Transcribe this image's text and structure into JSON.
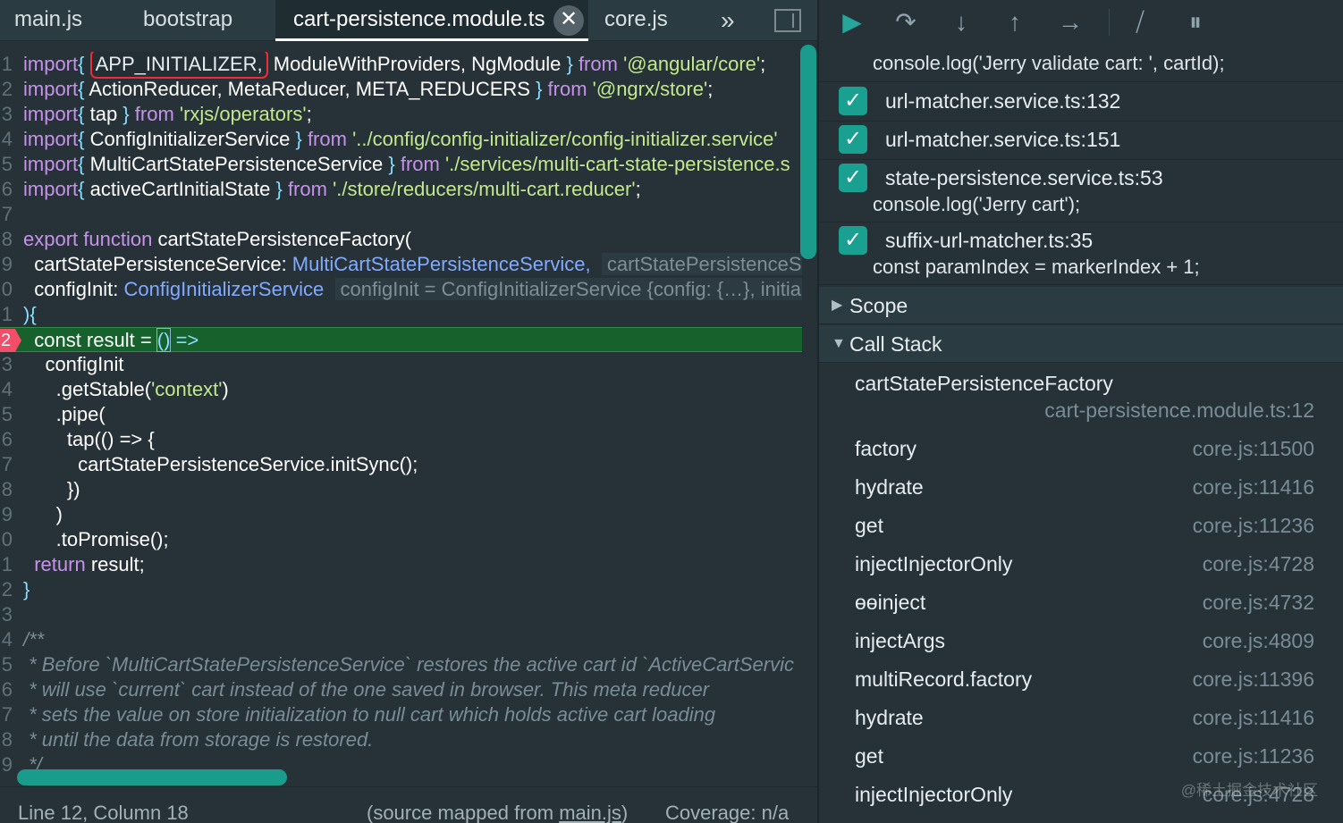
{
  "tabs": [
    {
      "label": "main.js",
      "active": false
    },
    {
      "label": "bootstrap",
      "active": false
    },
    {
      "label": "cart-persistence.module.ts",
      "active": true
    },
    {
      "label": "core.js",
      "active": false
    }
  ],
  "tab_close_glyph": "✕",
  "tab_overflow_glyph": "»",
  "breakpoint_line": "2",
  "status": {
    "position": "Line 12, Column 18",
    "source_mapped_prefix": "(source mapped from ",
    "source_mapped_file": "main.js",
    "source_mapped_suffix": ")",
    "coverage": "Coverage: n/a"
  },
  "code_lines": [
    {
      "no": "1",
      "parts": [
        [
          "kw",
          "import"
        ],
        [
          "pn",
          "{ "
        ],
        [
          "box",
          "APP_INITIALIZER,"
        ],
        [
          "fn",
          " ModuleWithProviders, NgModule "
        ],
        [
          "pn",
          "} "
        ],
        [
          "kw",
          "from "
        ],
        [
          "str",
          "'@angular/core'"
        ],
        [
          "fn",
          ";"
        ]
      ]
    },
    {
      "no": "2",
      "parts": [
        [
          "kw",
          "import"
        ],
        [
          "pn",
          "{ "
        ],
        [
          "fn",
          "ActionReducer, MetaReducer, META_REDUCERS "
        ],
        [
          "pn",
          "} "
        ],
        [
          "kw",
          "from "
        ],
        [
          "str",
          "'@ngrx/store'"
        ],
        [
          "fn",
          ";"
        ]
      ]
    },
    {
      "no": "3",
      "parts": [
        [
          "kw",
          "import"
        ],
        [
          "pn",
          "{ "
        ],
        [
          "fn",
          "tap "
        ],
        [
          "pn",
          "} "
        ],
        [
          "kw",
          "from "
        ],
        [
          "str",
          "'rxjs/operators'"
        ],
        [
          "fn",
          ";"
        ]
      ]
    },
    {
      "no": "4",
      "parts": [
        [
          "kw",
          "import"
        ],
        [
          "pn",
          "{ "
        ],
        [
          "fn",
          "ConfigInitializerService "
        ],
        [
          "pn",
          "} "
        ],
        [
          "kw",
          "from "
        ],
        [
          "str",
          "'../config/config-initializer/config-initializer.service'"
        ]
      ]
    },
    {
      "no": "5",
      "parts": [
        [
          "kw",
          "import"
        ],
        [
          "pn",
          "{ "
        ],
        [
          "fn",
          "MultiCartStatePersistenceService "
        ],
        [
          "pn",
          "} "
        ],
        [
          "kw",
          "from "
        ],
        [
          "str",
          "'./services/multi-cart-state-persistence.s"
        ]
      ]
    },
    {
      "no": "6",
      "parts": [
        [
          "kw",
          "import"
        ],
        [
          "pn",
          "{ "
        ],
        [
          "fn",
          "activeCartInitialState "
        ],
        [
          "pn",
          "} "
        ],
        [
          "kw",
          "from "
        ],
        [
          "str",
          "'./store/reducers/multi-cart.reducer'"
        ],
        [
          "fn",
          ";"
        ]
      ]
    },
    {
      "no": "7",
      "parts": []
    },
    {
      "no": "8",
      "parts": [
        [
          "kw",
          "export function "
        ],
        [
          "fn",
          "cartStatePersistenceFactory("
        ]
      ]
    },
    {
      "no": "9",
      "parts": [
        [
          "fn",
          "  cartStatePersistenceService: "
        ],
        [
          "ty",
          "MultiCartStatePersistenceService,"
        ],
        [
          "fn",
          "  "
        ],
        [
          "inl",
          "cartStatePersistenceS"
        ]
      ]
    },
    {
      "no": "0",
      "parts": [
        [
          "fn",
          "  configInit: "
        ],
        [
          "ty",
          "ConfigInitializerService"
        ],
        [
          "fn",
          "  "
        ],
        [
          "inl",
          "configInit = ConfigInitializerService {config: {…}, initia"
        ]
      ]
    },
    {
      "no": "1",
      "parts": [
        [
          "pn",
          "){"
        ]
      ]
    },
    {
      "no": "2",
      "hl": true,
      "parts": [
        [
          "fn",
          "  const result = "
        ],
        [
          "cur",
          "()"
        ],
        [
          "pn",
          " =>"
        ]
      ]
    },
    {
      "no": "3",
      "parts": [
        [
          "fn",
          "    configInit"
        ]
      ]
    },
    {
      "no": "4",
      "parts": [
        [
          "fn",
          "      .getStable("
        ],
        [
          "str",
          "'context'"
        ],
        [
          "fn",
          ")"
        ]
      ]
    },
    {
      "no": "5",
      "parts": [
        [
          "fn",
          "      .pipe("
        ]
      ]
    },
    {
      "no": "6",
      "parts": [
        [
          "fn",
          "        tap(() => {"
        ]
      ]
    },
    {
      "no": "7",
      "parts": [
        [
          "fn",
          "          cartStatePersistenceService.initSync();"
        ]
      ]
    },
    {
      "no": "8",
      "parts": [
        [
          "fn",
          "        })"
        ]
      ]
    },
    {
      "no": "9",
      "parts": [
        [
          "fn",
          "      )"
        ]
      ]
    },
    {
      "no": "0",
      "parts": [
        [
          "fn",
          "      .toPromise();"
        ]
      ]
    },
    {
      "no": "1",
      "parts": [
        [
          "kw",
          "  return "
        ],
        [
          "fn",
          "result;"
        ]
      ]
    },
    {
      "no": "2",
      "parts": [
        [
          "pn",
          "}"
        ]
      ]
    },
    {
      "no": "3",
      "parts": []
    },
    {
      "no": "4",
      "parts": [
        [
          "cm",
          "/**"
        ]
      ]
    },
    {
      "no": "5",
      "parts": [
        [
          "cm",
          " * Before `MultiCartStatePersistenceService` restores the active cart id `ActiveCartServic"
        ]
      ]
    },
    {
      "no": "6",
      "parts": [
        [
          "cm",
          " * will use `current` cart instead of the one saved in browser. This meta reducer"
        ]
      ]
    },
    {
      "no": "7",
      "parts": [
        [
          "cm",
          " * sets the value on store initialization to null cart which holds active cart loading"
        ]
      ]
    },
    {
      "no": "8",
      "parts": [
        [
          "cm",
          " * until the data from storage is restored."
        ]
      ]
    },
    {
      "no": "9",
      "parts": [
        [
          "cm",
          " */"
        ]
      ]
    }
  ],
  "toolbar_icons": [
    "resume-icon",
    "step-over-icon",
    "step-into-icon",
    "step-out-icon",
    "step-icon",
    "deactivate-breakpoints-icon",
    "pause-on-exceptions-icon"
  ],
  "toolbar_glyphs": [
    "▶",
    "↷",
    "↓",
    "↑",
    "→",
    "⧸",
    "⏸"
  ],
  "breakpoints_header_code": "console.log('Jerry validate cart: ', cartId);",
  "breakpoints": [
    {
      "file": "url-matcher.service.ts:132",
      "code": ""
    },
    {
      "file": "url-matcher.service.ts:151",
      "code": ""
    },
    {
      "file": "state-persistence.service.ts:53",
      "code": "console.log('Jerry cart');"
    },
    {
      "file": "suffix-url-matcher.ts:35",
      "code": "const paramIndex = markerIndex + 1;"
    }
  ],
  "check_glyph": "✓",
  "sections": {
    "scope": {
      "label": "Scope",
      "caret": "▶"
    },
    "call_stack": {
      "label": "Call Stack",
      "caret": "▼"
    }
  },
  "call_stack": [
    {
      "name": "cartStatePersistenceFactory",
      "location": "cart-persistence.module.ts:12"
    },
    {
      "name": "factory",
      "location": "core.js:11500"
    },
    {
      "name": "hydrate",
      "location": "core.js:11416"
    },
    {
      "name": "get",
      "location": "core.js:11236"
    },
    {
      "name": "injectInjectorOnly",
      "location": "core.js:4728"
    },
    {
      "name": "ɵɵinject",
      "location": "core.js:4732"
    },
    {
      "name": "injectArgs",
      "location": "core.js:4809"
    },
    {
      "name": "multiRecord.factory",
      "location": "core.js:11396"
    },
    {
      "name": "hydrate",
      "location": "core.js:11416"
    },
    {
      "name": "get",
      "location": "core.js:11236"
    },
    {
      "name": "injectInjectorOnly",
      "location": "core.js:4728"
    }
  ],
  "watermark": "@稀土掘金技术社区",
  "colors": {
    "accent": "#1aa090",
    "breakpoint": "#f44d6a",
    "highlight_line": "#17612d",
    "keyword": "#c792ea",
    "string": "#c3e88d",
    "type": "#82aaff"
  }
}
